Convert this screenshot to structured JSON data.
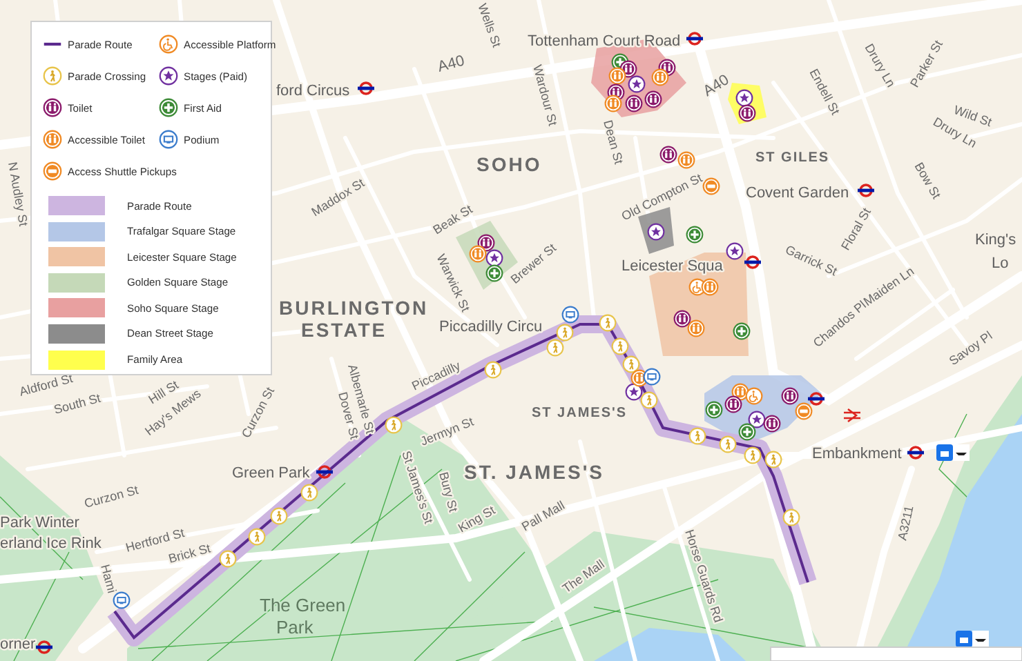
{
  "legend": {
    "symbols": [
      {
        "label": "Parade Route",
        "kind": "route"
      },
      {
        "label": "Accessible Platform",
        "kind": "platform"
      },
      {
        "label": "Parade Crossing",
        "kind": "crossing"
      },
      {
        "label": "Stages (Paid)",
        "kind": "stage"
      },
      {
        "label": "Toilet",
        "kind": "toilet"
      },
      {
        "label": "First Aid",
        "kind": "firstaid"
      },
      {
        "label": "Accessible Toilet",
        "kind": "atoilet"
      },
      {
        "label": "Podium",
        "kind": "podium"
      },
      {
        "label": "Access Shuttle Pickups",
        "kind": "shuttle"
      }
    ],
    "areas": [
      {
        "label": "Parade Route",
        "color": "#cdb5e0"
      },
      {
        "label": "Trafalgar Square Stage",
        "color": "#b4c7e7"
      },
      {
        "label": "Leicester Square Stage",
        "color": "#f0c4a4"
      },
      {
        "label": "Golden Square Stage",
        "color": "#c5d9b8"
      },
      {
        "label": "Soho Square Stage",
        "color": "#e8a0a0"
      },
      {
        "label": "Dean Street Stage",
        "color": "#8c8c8c"
      },
      {
        "label": "Family Area",
        "color": "#ffff4d"
      }
    ]
  },
  "map_labels": [
    {
      "text": "Tottenham Court Road",
      "kind": "station"
    },
    {
      "text": "A40",
      "kind": "road"
    },
    {
      "text": "A40",
      "kind": "road"
    },
    {
      "text": "ford Circus",
      "kind": "station"
    },
    {
      "text": "Wells St",
      "kind": "street"
    },
    {
      "text": "Wardour St",
      "kind": "street"
    },
    {
      "text": "Dean St",
      "kind": "street"
    },
    {
      "text": "SOHO",
      "kind": "district"
    },
    {
      "text": "Maddox St",
      "kind": "street"
    },
    {
      "text": "Beak St",
      "kind": "street"
    },
    {
      "text": "Warwick St",
      "kind": "street"
    },
    {
      "text": "Brewer St",
      "kind": "street"
    },
    {
      "text": "BURLINGTON",
      "kind": "district"
    },
    {
      "text": "ESTATE",
      "kind": "district"
    },
    {
      "text": "Piccadilly Circu",
      "kind": "station"
    },
    {
      "text": "Old Compton St",
      "kind": "street"
    },
    {
      "text": "Leicester Squa",
      "kind": "station"
    },
    {
      "text": "ST GILES",
      "kind": "quarter"
    },
    {
      "text": "Covent Garden",
      "kind": "station"
    },
    {
      "text": "Endell St",
      "kind": "street"
    },
    {
      "text": "Drury Ln",
      "kind": "street"
    },
    {
      "text": "Parker St",
      "kind": "street"
    },
    {
      "text": "Wild St",
      "kind": "street"
    },
    {
      "text": "Drury Ln",
      "kind": "street"
    },
    {
      "text": "Bow St",
      "kind": "street"
    },
    {
      "text": "Floral St",
      "kind": "street"
    },
    {
      "text": "Garrick St",
      "kind": "street"
    },
    {
      "text": "Chandos Pl",
      "kind": "street"
    },
    {
      "text": "Maiden Ln",
      "kind": "street"
    },
    {
      "text": "Savoy Pl",
      "kind": "street"
    },
    {
      "text": "King's",
      "kind": "station"
    },
    {
      "text": "Lo",
      "kind": "station"
    },
    {
      "text": "Embankment",
      "kind": "station"
    },
    {
      "text": "A3211",
      "kind": "street"
    },
    {
      "text": "Horse Guards Rd",
      "kind": "street"
    },
    {
      "text": "The Mall",
      "kind": "street"
    },
    {
      "text": "Pall Mall",
      "kind": "street"
    },
    {
      "text": "ST JAMES'S",
      "kind": "quarter"
    },
    {
      "text": "ST. JAMES'S",
      "kind": "district"
    },
    {
      "text": "Jermyn St",
      "kind": "street"
    },
    {
      "text": "Bury St",
      "kind": "street"
    },
    {
      "text": "King St",
      "kind": "street"
    },
    {
      "text": "St James's St",
      "kind": "street"
    },
    {
      "text": "Albemarle St",
      "kind": "street"
    },
    {
      "text": "Dover St",
      "kind": "street"
    },
    {
      "text": "Piccadilly",
      "kind": "street"
    },
    {
      "text": "Green Park",
      "kind": "station"
    },
    {
      "text": "Curzon St",
      "kind": "street"
    },
    {
      "text": "Curzon St",
      "kind": "street"
    },
    {
      "text": "Hill St",
      "kind": "street"
    },
    {
      "text": "Hay's Mews",
      "kind": "street"
    },
    {
      "text": "South St",
      "kind": "street"
    },
    {
      "text": "Aldford St",
      "kind": "street"
    },
    {
      "text": "Hertford St",
      "kind": "street"
    },
    {
      "text": "Brick St",
      "kind": "street"
    },
    {
      "text": "The Green",
      "kind": "park"
    },
    {
      "text": "Park",
      "kind": "park"
    },
    {
      "text": "Park Winter",
      "kind": "station"
    },
    {
      "text": "erland Ice Rink",
      "kind": "station"
    },
    {
      "text": "Hami",
      "kind": "street"
    },
    {
      "text": "orner",
      "kind": "station"
    },
    {
      "text": "N Audley St",
      "kind": "street"
    }
  ]
}
